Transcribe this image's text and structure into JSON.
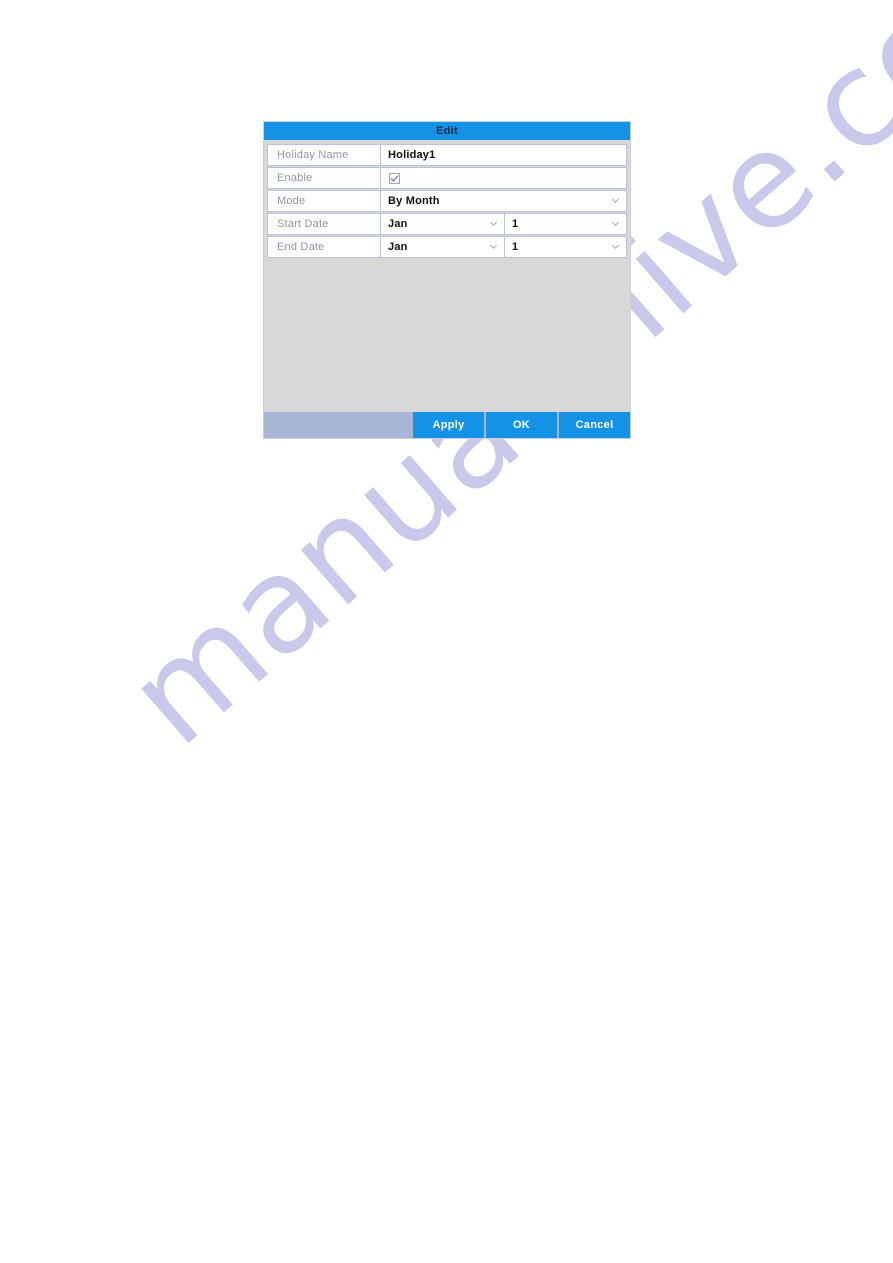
{
  "page": {
    "background_color": "#ffffff",
    "watermark_text": "manualshive.com",
    "watermark_color": "#c9c9ec"
  },
  "dialog": {
    "title": "Edit",
    "title_bar_color": "#1492e6",
    "body_color": "#d8d8d8",
    "footer_color": "#a6b6d4",
    "accent_color": "#1492e6",
    "rows": [
      {
        "label": "Holiday Name",
        "type": "text",
        "value": "Holiday1"
      },
      {
        "label": "Enable",
        "type": "checkbox",
        "checked": true,
        "value": ""
      },
      {
        "label": "Mode",
        "type": "select",
        "value": "By Month"
      },
      {
        "label": "Start Date",
        "type": "select-pair",
        "month_value": "Jan",
        "day_value": "1"
      },
      {
        "label": "End Date",
        "type": "select-pair",
        "month_value": "Jan",
        "day_value": "1"
      }
    ],
    "footer": {
      "apply_label": "Apply",
      "ok_label": "OK",
      "cancel_label": "Cancel"
    }
  }
}
